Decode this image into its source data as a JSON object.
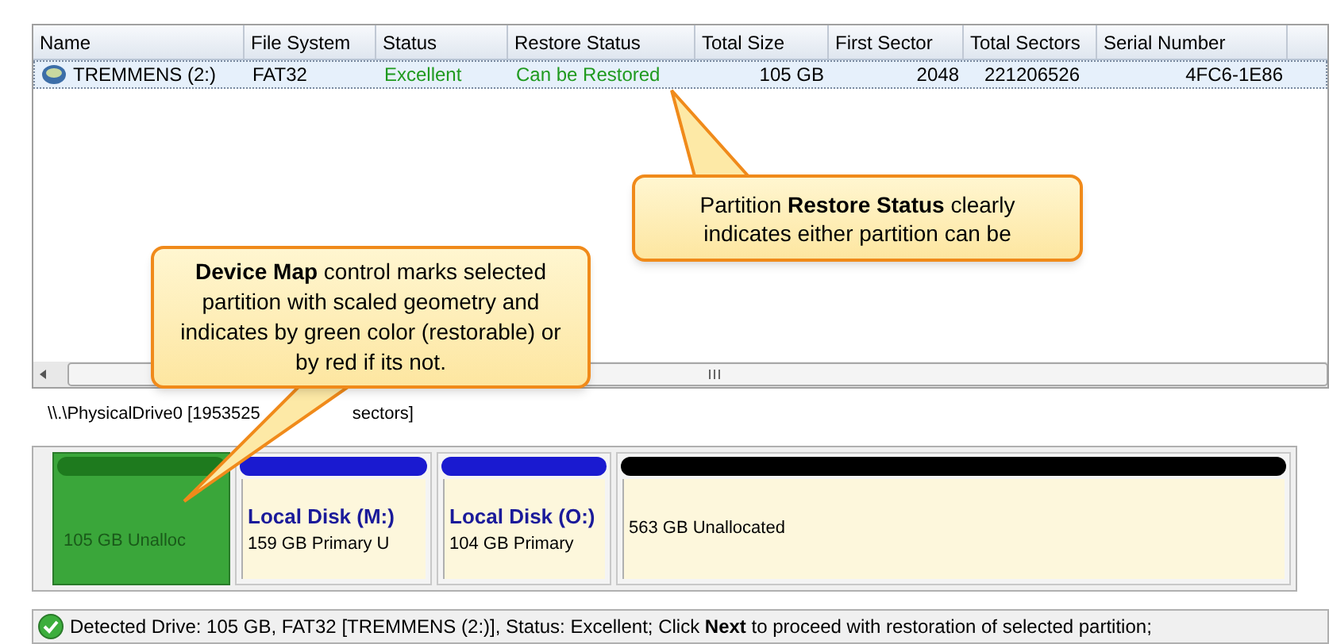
{
  "table": {
    "columns": [
      "Name",
      "File System",
      "Status",
      "Restore Status",
      "Total Size",
      "First Sector",
      "Total Sectors",
      "Serial Number"
    ],
    "rows": [
      {
        "selected": true,
        "cells": [
          "TREMMENS (2:)",
          "FAT32",
          "Excellent",
          "Can be Restored",
          "105 GB",
          "2048",
          "221206526",
          "4FC6-1E86"
        ]
      }
    ]
  },
  "callouts": [
    {
      "text": "Partition **Restore Status** clearly indicates either partition can be"
    },
    {
      "text": "**Device Map** control marks selected partition with scaled geometry and indicates by green color (restorable) or by red if its not."
    }
  ],
  "device_map": {
    "label_parts": [
      "\\\\.\\PhysicalDrive0 [1953525",
      "sectors]"
    ],
    "partitions": [
      {
        "selected": true,
        "color": "#1e7a1e",
        "detail": "105 GB  Unalloc"
      },
      {
        "selected": false,
        "color": "#1a1ad0",
        "title": "Local Disk (M:)",
        "detail": "159 GB Primary U"
      },
      {
        "selected": false,
        "color": "#1a1ad0",
        "title": "Local Disk (O:)",
        "detail": "104 GB Primary"
      },
      {
        "selected": false,
        "color": "#000000",
        "detail": "563 GB  Unallocated"
      }
    ]
  },
  "status_bar": {
    "text": "Detected Drive: 105 GB, FAT32 [TREMMENS (2:)], Status: Excellent; Click **Next** to proceed with restoration of selected partition;"
  }
}
